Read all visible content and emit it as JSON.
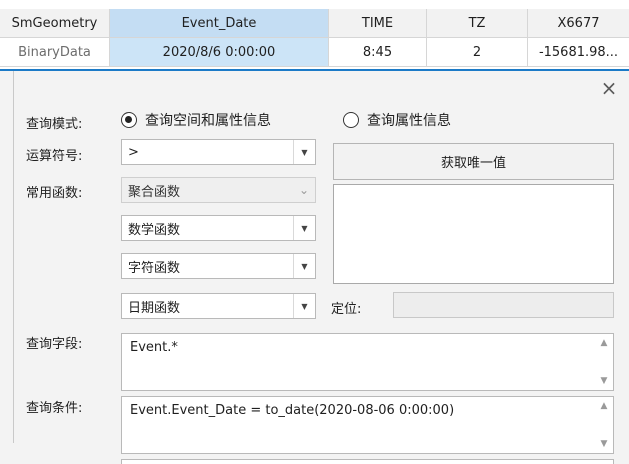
{
  "table": {
    "headers": [
      "SmGeometry",
      "Event_Date",
      "TIME",
      "TZ",
      "X6677"
    ],
    "row": [
      "BinaryData",
      "2020/8/6 0:00:00",
      "8:45",
      "2",
      "-15681.98..."
    ]
  },
  "dialog": {
    "close_glyph": "×",
    "query_mode_label": "查询模式:",
    "radio_spatial_label": "查询空间和属性信息",
    "radio_attribute_label": "查询属性信息",
    "operator_label": "运算符号:",
    "operator_value": ">",
    "common_functions_label": "常用函数:",
    "aggregate_value": "聚合函数",
    "math_value": "数学函数",
    "string_value": "字符函数",
    "date_value": "日期函数",
    "get_unique_button": "获取唯一值",
    "locate_label": "定位:",
    "query_fields_label": "查询字段:",
    "query_fields_value": "Event.*",
    "query_condition_label": "查询条件:",
    "query_condition_value": "Event.Event_Date = to_date(2020-08-06 0:00:00)"
  },
  "colors": {
    "selected_header": "#c4ddf3",
    "selected_cell": "#cce4f7",
    "accent_line": "#1b7ac7",
    "dialog_bg": "#f3f3f3"
  },
  "icons": [
    "close-icon",
    "dropdown-arrow-icon",
    "chevron-down-icon",
    "scroll-up-icon",
    "scroll-down-icon"
  ]
}
